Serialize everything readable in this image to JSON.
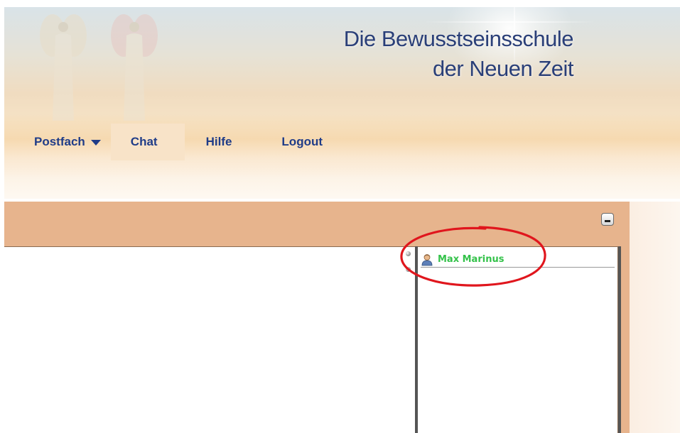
{
  "header": {
    "title_line1": "Die Bewusstseinsschule",
    "title_line2": "der Neuen Zeit"
  },
  "nav": {
    "items": [
      {
        "label": "Postfach",
        "has_dropdown": true,
        "active": false
      },
      {
        "label": "Chat",
        "has_dropdown": false,
        "active": true
      },
      {
        "label": "Hilfe",
        "has_dropdown": false,
        "active": false
      },
      {
        "label": "Logout",
        "has_dropdown": false,
        "active": false
      }
    ]
  },
  "chat": {
    "users": [
      {
        "name": "Max Marinus",
        "icon": "user-icon",
        "status_color": "#34c24a"
      }
    ],
    "minimize_icon": "minimize-icon"
  },
  "colors": {
    "nav_text": "#1f3c88",
    "title_text": "#2a3f78",
    "panel_bar": "#e7b48d",
    "highlight_circle": "#e0161d",
    "user_online": "#34c24a"
  }
}
